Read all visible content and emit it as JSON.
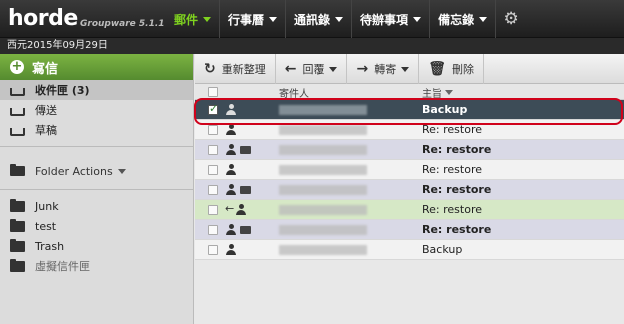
{
  "header": {
    "logo": "horde",
    "product": "Groupware 5.1.1",
    "menu": [
      {
        "label": "郵件",
        "active": true
      },
      {
        "label": "行事曆",
        "active": false
      },
      {
        "label": "通訊錄",
        "active": false
      },
      {
        "label": "待辦事項",
        "active": false
      },
      {
        "label": "備忘錄",
        "active": false
      }
    ],
    "settings_icon": "gear-icon",
    "date": "西元2015年09月29日"
  },
  "sidebar": {
    "compose_label": "寫信",
    "mailboxes": [
      {
        "label": "收件匣 (3)",
        "icon": "inbox-icon",
        "selected": true
      },
      {
        "label": "傳送",
        "icon": "sent-icon",
        "selected": false
      },
      {
        "label": "草稿",
        "icon": "drafts-icon",
        "selected": false
      }
    ],
    "folder_actions": "Folder Actions",
    "folders": [
      {
        "label": "Junk",
        "icon": "folder-icon"
      },
      {
        "label": "test",
        "icon": "folder-icon"
      },
      {
        "label": "Trash",
        "icon": "folder-icon"
      },
      {
        "label": "虛擬信件匣",
        "icon": "virtual-folder-icon"
      }
    ]
  },
  "toolbar": {
    "refresh": "重新整理",
    "reply": "回覆",
    "forward": "轉寄",
    "delete": "刪除"
  },
  "list": {
    "columns": {
      "from": "寄件人",
      "subject": "主旨"
    },
    "rows": [
      {
        "subject": "Backup",
        "style": "selected",
        "checked": true,
        "attachment": false,
        "replied": false
      },
      {
        "subject": "Re: restore",
        "style": "plain",
        "checked": false,
        "attachment": false,
        "replied": false
      },
      {
        "subject": "Re: restore",
        "style": "purple-unread",
        "checked": false,
        "attachment": true,
        "replied": false
      },
      {
        "subject": "Re: restore",
        "style": "plain",
        "checked": false,
        "attachment": false,
        "replied": false
      },
      {
        "subject": "Re: restore",
        "style": "purple-unread",
        "checked": false,
        "attachment": true,
        "replied": false
      },
      {
        "subject": "Re: restore",
        "style": "green",
        "checked": false,
        "attachment": false,
        "replied": true
      },
      {
        "subject": "Re: restore",
        "style": "purple-unread",
        "checked": false,
        "attachment": true,
        "replied": false
      },
      {
        "subject": "Backup",
        "style": "plain",
        "checked": false,
        "attachment": false,
        "replied": false
      }
    ]
  },
  "colors": {
    "accent_green": "#7cb342",
    "selected_row": "#3d4c57",
    "highlight": "#d0021b"
  }
}
